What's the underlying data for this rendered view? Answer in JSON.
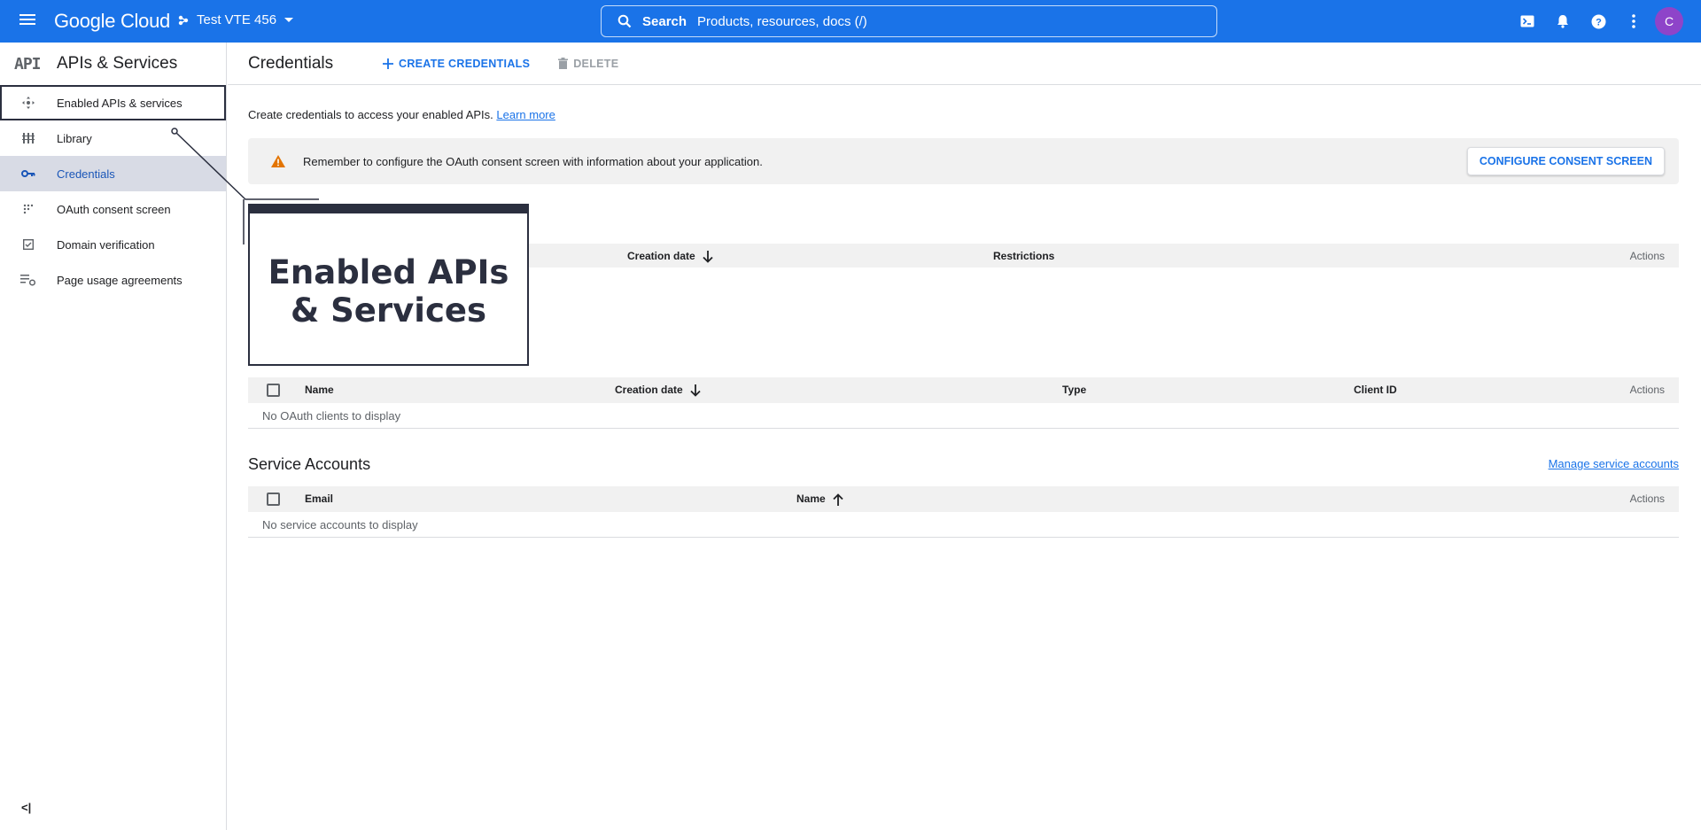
{
  "topbar": {
    "logo": "Google Cloud",
    "project": "Test VTE 456",
    "search_label": "Search",
    "search_placeholder": "Products, resources, docs (/)",
    "avatar_initial": "C"
  },
  "sidebar": {
    "title": "APIs & Services",
    "logo_text": "API",
    "items": [
      {
        "label": "Enabled APIs & services",
        "icon": "apis-icon"
      },
      {
        "label": "Library",
        "icon": "library-icon"
      },
      {
        "label": "Credentials",
        "icon": "key-icon"
      },
      {
        "label": "OAuth consent screen",
        "icon": "consent-icon"
      },
      {
        "label": "Domain verification",
        "icon": "checkbox-icon"
      },
      {
        "label": "Page usage agreements",
        "icon": "settings-list-icon"
      }
    ],
    "collapse_label": "<|"
  },
  "main": {
    "title": "Credentials",
    "create_label": "CREATE CREDENTIALS",
    "delete_label": "DELETE",
    "intro_text": "Create credentials to access your enabled APIs.",
    "learn_more": "Learn more",
    "banner_text": "Remember to configure the OAuth consent screen with information about your application.",
    "configure_label": "CONFIGURE CONSENT SCREEN"
  },
  "api_keys_table": {
    "headers": {
      "creation_date": "Creation date",
      "restrictions": "Restrictions",
      "actions": "Actions"
    }
  },
  "oauth_table": {
    "headers": {
      "name": "Name",
      "creation_date": "Creation date",
      "type": "Type",
      "client_id": "Client ID",
      "actions": "Actions"
    },
    "empty": "No OAuth clients to display"
  },
  "service_accounts": {
    "title": "Service Accounts",
    "manage_link": "Manage service accounts",
    "headers": {
      "email": "Email",
      "name": "Name",
      "actions": "Actions"
    },
    "empty": "No service accounts to display"
  },
  "callout": {
    "text": "Enabled APIs & Services"
  },
  "colors": {
    "topbar": "#1a73e8",
    "active_item": "#d8dbe5",
    "warning": "#e37400",
    "callout": "#2b2f3f"
  }
}
